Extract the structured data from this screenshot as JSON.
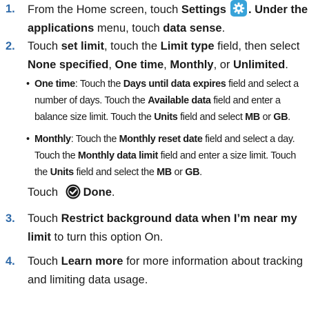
{
  "steps": {
    "s1": {
      "num": "1.",
      "t1": "From the Home screen, touch ",
      "b1": "Settings",
      "t2": ". Under the",
      "b2": "applications",
      "t3": " menu, touch ",
      "b3": "data sense",
      "t4": "."
    },
    "s2": {
      "num": "2.",
      "t1": "Touch ",
      "b1": "set limit",
      "t2": ", touch the ",
      "b2": "Limit type",
      "t3": " field, then select",
      "b3": "None specified",
      "t4": ", ",
      "b4": "One time",
      "t5": ", ",
      "b5": "Monthly",
      "t6": ", or ",
      "b6": "Unlimited",
      "t7": "."
    },
    "s2a": {
      "bullet": "•",
      "b1": "One time",
      "t1": ": Touch the ",
      "b2": "Days until data expires",
      "t2": " field and select a",
      "t3": "number of days. Touch the ",
      "b3": "Available data",
      "t4": " field and enter a",
      "t5": "balance size limit. Touch the ",
      "b4": "Units",
      "t6": " field and select ",
      "b5": "MB",
      "t7": " or ",
      "b6": "GB",
      "t8": "."
    },
    "s2b": {
      "bullet": "•",
      "b1": "Monthly",
      "t1": ": Touch the ",
      "b2": "Monthly reset date",
      "t2": " field and select a day.",
      "t3": "Touch the ",
      "b3": "Monthly data limit",
      "t4": " field and enter a size limit. Touch",
      "t5": "the ",
      "b4": "Units",
      "t6": " field and select the ",
      "b5": "MB",
      "t7": " or ",
      "b6": "GB",
      "t8": "."
    },
    "s2c": {
      "t1": "Touch ",
      "b1": "Done",
      "t2": "."
    },
    "s3": {
      "num": "3.",
      "t1": "Touch ",
      "b1": "Restrict background data when I’m near my",
      "b2": "limit",
      "t2": " to turn this option On."
    },
    "s4": {
      "num": "4.",
      "t1": "Touch ",
      "b1": "Learn more",
      "t2": " for more information about tracking",
      "t3": "and limiting data usage."
    }
  },
  "icons": {
    "settings": "settings-gear-icon",
    "done": "done-check-circle-icon"
  },
  "colors": {
    "step_number": "#2e69a8",
    "settings_icon_bg": "#38a3d9",
    "text": "#1a1a1a"
  }
}
